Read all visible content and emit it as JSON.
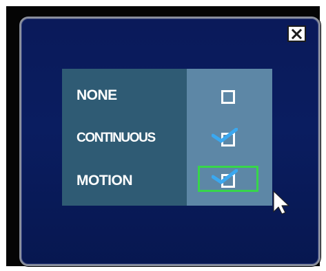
{
  "dialog": {
    "close_glyph": "×"
  },
  "options": [
    {
      "label": "NONE",
      "checked": false,
      "focused": false
    },
    {
      "label": "CONTINUOUS",
      "checked": true,
      "focused": false
    },
    {
      "label": "MOTION",
      "checked": true,
      "focused": true
    }
  ],
  "colors": {
    "dialog_background": "#0a1a5a",
    "label_column": "#2f5b74",
    "checkbox_column": "#5d87a6",
    "check_mark": "#3aa8f0",
    "focus_outline": "#37d64a"
  },
  "icons": {
    "close": "close-icon",
    "check": "check-icon",
    "pointer": "mouse-pointer-icon"
  }
}
